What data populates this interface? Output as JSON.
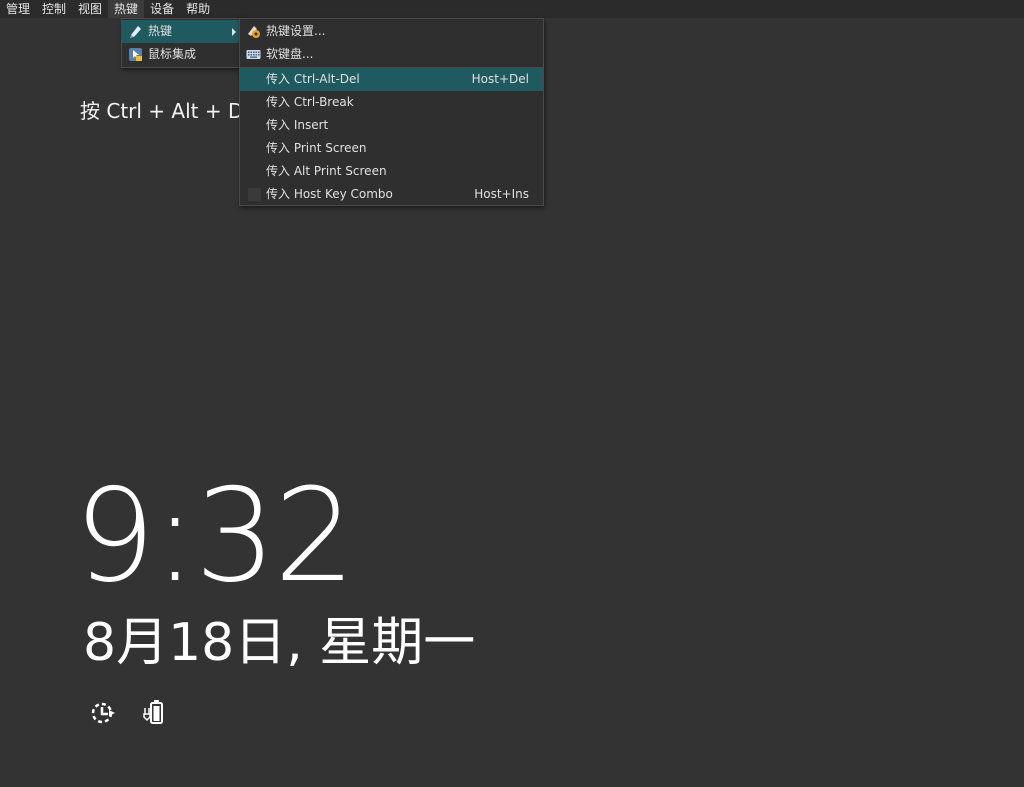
{
  "menubar": {
    "items": [
      "管理",
      "控制",
      "视图",
      "热键",
      "设备",
      "帮助"
    ]
  },
  "hotkey_menu": {
    "items": [
      {
        "label": "热键",
        "icon": "hotkey-icon",
        "has_submenu": true
      },
      {
        "label": "鼠标集成",
        "icon": "mouse-integration-icon",
        "has_submenu": false
      }
    ]
  },
  "hotkey_submenu": {
    "items": [
      {
        "label": "热键设置...",
        "icon": "hotkey-settings-icon"
      },
      {
        "label": "软键盘...",
        "icon": "keyboard-icon"
      }
    ],
    "commands": [
      {
        "label": "传入 Ctrl-Alt-Del",
        "shortcut": "Host+Del"
      },
      {
        "label": "传入 Ctrl-Break",
        "shortcut": ""
      },
      {
        "label": "传入 Insert",
        "shortcut": ""
      },
      {
        "label": "传入 Print Screen",
        "shortcut": ""
      },
      {
        "label": "传入 Alt Print Screen",
        "shortcut": ""
      },
      {
        "label": "传入 Host Key Combo",
        "shortcut": "Host+Ins"
      }
    ]
  },
  "lockscreen": {
    "hint": "按 Ctrl + Alt + D",
    "time": "9:32",
    "date": "8月18日, 星期一"
  },
  "colors": {
    "background": "#333333",
    "menu_highlight": "#1f5a60"
  }
}
